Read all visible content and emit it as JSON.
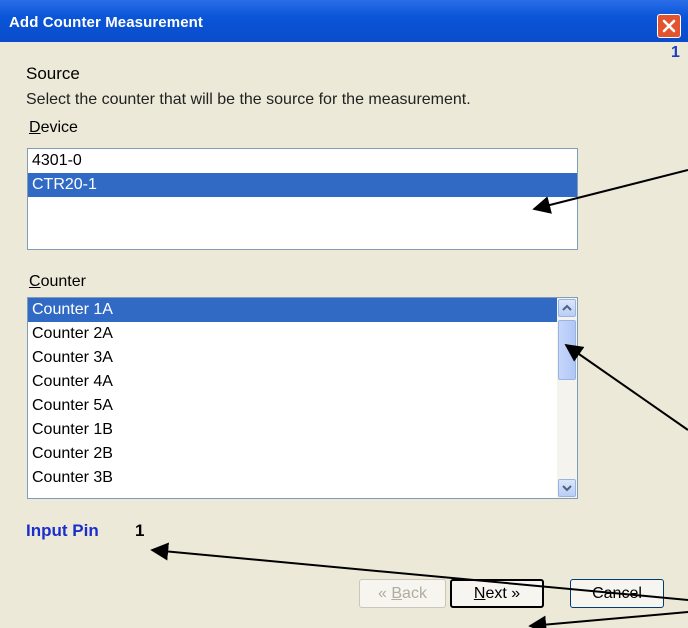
{
  "window": {
    "title": "Add Counter Measurement",
    "page_number": "1"
  },
  "section": {
    "heading": "Source",
    "instruction": "Select the counter that will be the source for the measurement."
  },
  "device": {
    "label_accel": "D",
    "label_rest": "evice",
    "items": [
      "4301-0",
      "CTR20-1"
    ],
    "selected": "CTR20-1"
  },
  "counter": {
    "label_accel": "C",
    "label_rest": "ounter",
    "items": [
      "Counter 1A",
      "Counter 2A",
      "Counter 3A",
      "Counter 4A",
      "Counter 5A",
      "Counter 1B",
      "Counter 2B",
      "Counter 3B"
    ],
    "selected": "Counter 1A"
  },
  "input_pin": {
    "label": "Input Pin",
    "value": "1"
  },
  "buttons": {
    "back_prefix": "« ",
    "back_accel": "B",
    "back_rest": "ack",
    "next_accel": "N",
    "next_rest": "ext",
    "next_suffix": " »",
    "cancel": "Cancel"
  },
  "colors": {
    "titlebar": "#0a55d8",
    "selection": "#316ac5",
    "dialog_bg": "#ece9d8",
    "pin_label": "#1a2ecc",
    "close_button": "#e2532e"
  },
  "icons": {
    "close": "close-icon",
    "scroll_up": "chevron-up-icon",
    "scroll_down": "chevron-down-icon"
  }
}
